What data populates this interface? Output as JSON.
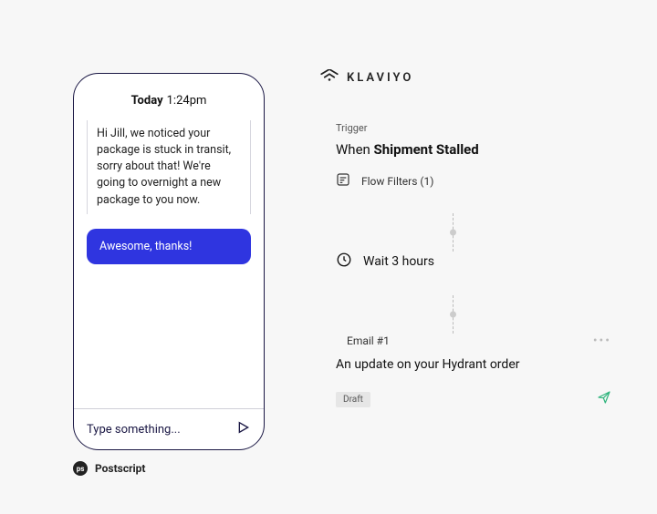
{
  "phone": {
    "header_day": "Today",
    "header_time": "1:24pm",
    "incoming": "Hi Jill, we noticed your package is stuck in transit, sorry about that! We're going to overnight a new package to you now.",
    "outgoing": "Awesome, thanks!",
    "input_placeholder": "Type something..."
  },
  "postscript": {
    "badge": "ps",
    "label": "Postscript"
  },
  "klaviyo": {
    "brand": "KLAVIYO",
    "trigger_caption": "Trigger",
    "trigger_prefix": "When ",
    "trigger_event": "Shipment Stalled",
    "flow_filters": "Flow Filters (1)",
    "wait": "Wait 3 hours",
    "email": {
      "label": "Email #1",
      "subject": "An update on your Hydrant order",
      "status": "Draft"
    }
  }
}
